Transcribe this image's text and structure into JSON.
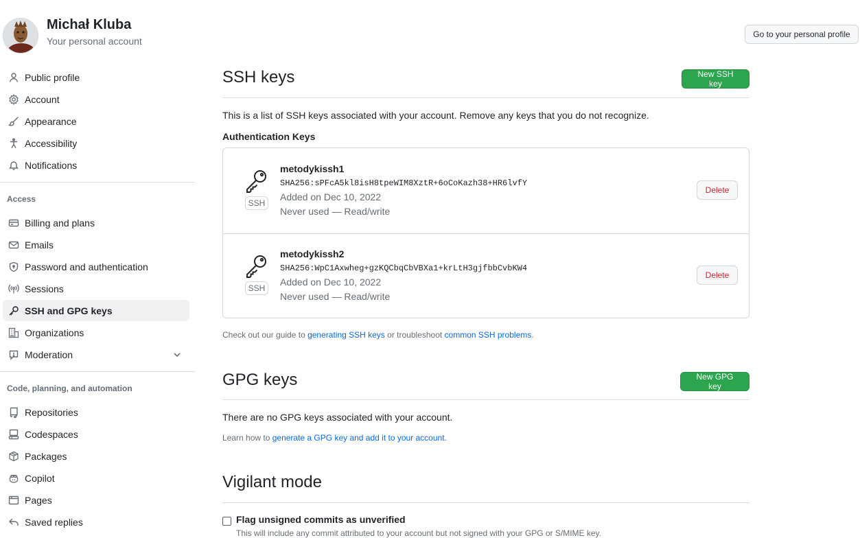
{
  "header": {
    "user_name": "Michał Kluba",
    "user_subtitle": "Your personal account",
    "profile_button": "Go to your personal profile"
  },
  "sidebar": {
    "top_items": [
      {
        "label": "Public profile",
        "icon": "person-icon"
      },
      {
        "label": "Account",
        "icon": "gear-icon"
      },
      {
        "label": "Appearance",
        "icon": "paintbrush-icon"
      },
      {
        "label": "Accessibility",
        "icon": "accessibility-icon"
      },
      {
        "label": "Notifications",
        "icon": "bell-icon"
      }
    ],
    "access_heading": "Access",
    "access_items": [
      {
        "label": "Billing and plans",
        "icon": "credit-card-icon"
      },
      {
        "label": "Emails",
        "icon": "mail-icon"
      },
      {
        "label": "Password and authentication",
        "icon": "shield-lock-icon"
      },
      {
        "label": "Sessions",
        "icon": "broadcast-icon"
      },
      {
        "label": "SSH and GPG keys",
        "icon": "key-icon",
        "active": true
      },
      {
        "label": "Organizations",
        "icon": "organization-icon"
      },
      {
        "label": "Moderation",
        "icon": "report-icon"
      }
    ],
    "code_heading": "Code, planning, and automation",
    "code_items": [
      {
        "label": "Repositories",
        "icon": "repo-icon"
      },
      {
        "label": "Codespaces",
        "icon": "codespaces-icon"
      },
      {
        "label": "Packages",
        "icon": "package-icon"
      },
      {
        "label": "Copilot",
        "icon": "copilot-icon"
      },
      {
        "label": "Pages",
        "icon": "browser-icon"
      },
      {
        "label": "Saved replies",
        "icon": "reply-icon"
      }
    ]
  },
  "ssh": {
    "title": "SSH keys",
    "new_button": "New SSH key",
    "intro": "This is a list of SSH keys associated with your account. Remove any keys that you do not recognize.",
    "subheading": "Authentication Keys",
    "keys": [
      {
        "name": "metodykissh1",
        "fingerprint": "SHA256:sPFcA5kl8isH8tpeWIM8XztR+6oCoKazh38+HR6lvfY",
        "added": "Added on Dec 10, 2022",
        "usage": "Never used — Read/write",
        "badge": "SSH",
        "delete_label": "Delete"
      },
      {
        "name": "metodykissh2",
        "fingerprint": "SHA256:WpC1Axwheg+gzKQCbqCbVBXa1+krLtH3gjfbbCvbKW4",
        "added": "Added on Dec 10, 2022",
        "usage": "Never used — Read/write",
        "badge": "SSH",
        "delete_label": "Delete"
      }
    ],
    "guide_prefix": "Check out our guide to ",
    "guide_link1": "generating SSH keys",
    "guide_middle": " or troubleshoot ",
    "guide_link2": "common SSH problems",
    "guide_suffix": "."
  },
  "gpg": {
    "title": "GPG keys",
    "new_button": "New GPG key",
    "empty_text": "There are no GPG keys associated with your account.",
    "learn_prefix": "Learn how to ",
    "learn_link": "generate a GPG key and add it to your account",
    "learn_suffix": "."
  },
  "vigilant": {
    "title": "Vigilant mode",
    "checkbox_label": "Flag unsigned commits as unverified",
    "checkbox_checked": false,
    "description": "This will include any commit attributed to your account but not signed with your GPG or S/MIME key."
  },
  "colors": {
    "primary_green": "#2da44e",
    "link_blue": "#0969da",
    "danger_red": "#cf222e",
    "muted_text": "#656d76",
    "border": "#d0d7de"
  }
}
